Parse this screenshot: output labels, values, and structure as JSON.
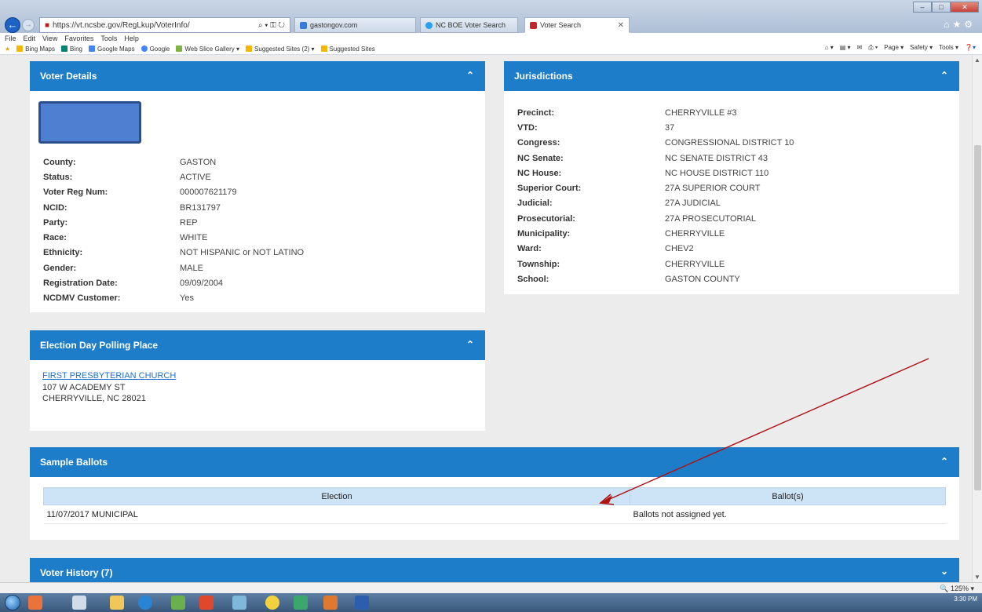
{
  "browser": {
    "url": "https://vt.ncsbe.gov/RegLkup/VoterInfo/",
    "search_tab": "gastongov.com",
    "tabs": [
      {
        "label": "NC BOE Voter Search",
        "active": false
      },
      {
        "label": "Voter Search",
        "active": true
      }
    ],
    "menu": [
      "File",
      "Edit",
      "View",
      "Favorites",
      "Tools",
      "Help"
    ],
    "favorites": [
      "Bing Maps",
      "Bing",
      "Google Maps",
      "Google",
      "Web Slice Gallery ▾",
      "Suggested Sites (2) ▾",
      "Suggested Sites"
    ],
    "toolbar_right": [
      "Page ▾",
      "Safety ▾",
      "Tools ▾"
    ],
    "zoom": "125%",
    "clock": "3:30 PM"
  },
  "voter_details": {
    "title": "Voter Details",
    "fields": [
      {
        "label": "County:",
        "value": "GASTON"
      },
      {
        "label": "Status:",
        "value": "ACTIVE"
      },
      {
        "label": "Voter Reg Num:",
        "value": "000007621179"
      },
      {
        "label": "NCID:",
        "value": "BR131797"
      },
      {
        "label": "Party:",
        "value": "REP"
      },
      {
        "label": "Race:",
        "value": "WHITE"
      },
      {
        "label": "Ethnicity:",
        "value": "NOT HISPANIC or NOT LATINO"
      },
      {
        "label": "Gender:",
        "value": "MALE"
      },
      {
        "label": "Registration Date:",
        "value": "09/09/2004"
      },
      {
        "label": "NCDMV Customer:",
        "value": "Yes"
      }
    ]
  },
  "jurisdictions": {
    "title": "Jurisdictions",
    "fields": [
      {
        "label": "Precinct:",
        "value": "CHERRYVILLE #3"
      },
      {
        "label": "VTD:",
        "value": "37"
      },
      {
        "label": "Congress:",
        "value": "CONGRESSIONAL DISTRICT 10"
      },
      {
        "label": "NC Senate:",
        "value": "NC SENATE DISTRICT 43"
      },
      {
        "label": "NC House:",
        "value": "NC HOUSE DISTRICT 110"
      },
      {
        "label": "Superior Court:",
        "value": "27A SUPERIOR COURT"
      },
      {
        "label": "Judicial:",
        "value": "27A JUDICIAL"
      },
      {
        "label": "Prosecutorial:",
        "value": "27A PROSECUTORIAL"
      },
      {
        "label": "Municipality:",
        "value": "CHERRYVILLE"
      },
      {
        "label": "Ward:",
        "value": "CHEV2"
      },
      {
        "label": "Township:",
        "value": "CHERRYVILLE"
      },
      {
        "label": "School:",
        "value": "GASTON COUNTY"
      }
    ]
  },
  "polling_place": {
    "title": "Election Day Polling Place",
    "name": "FIRST PRESBYTERIAN CHURCH",
    "address1": "107 W ACADEMY ST",
    "address2": "CHERRYVILLE, NC 28021"
  },
  "sample_ballots": {
    "title": "Sample Ballots",
    "col_election": "Election",
    "col_ballots": "Ballot(s)",
    "rows": [
      {
        "election": "11/07/2017 MUNICIPAL",
        "ballots": "Ballots not assigned yet."
      }
    ]
  },
  "voter_history": {
    "title": "Voter History (7)"
  },
  "colors": {
    "header_blue": "#1d7dc9",
    "annotation_arrow": "#b01010"
  }
}
